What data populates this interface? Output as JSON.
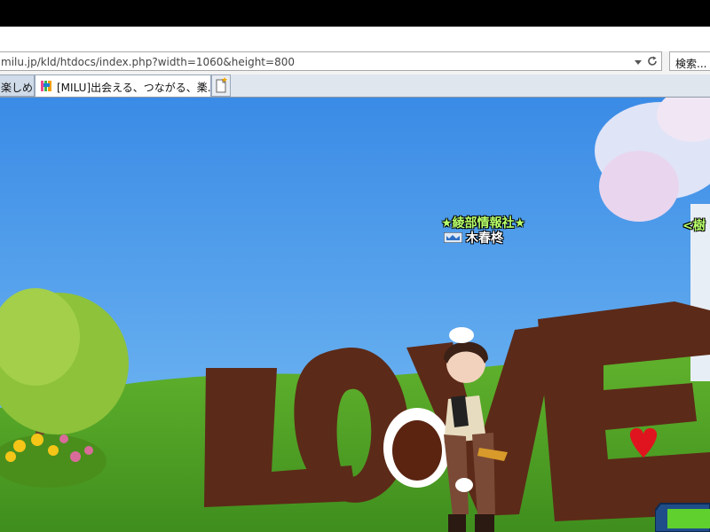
{
  "browser": {
    "address": {
      "url_dim": "milu.jp",
      "url_path": "/kld/htdocs/index.php?width=1060&height=800"
    },
    "search": {
      "label": "検索..."
    },
    "tabs": [
      {
        "label": "楽しめ..."
      },
      {
        "label": "[MILU]出会える、つながる、楽..."
      }
    ],
    "tab_close_glyph": "×"
  },
  "game": {
    "sign_text": "LOVE",
    "sign_color": "#5c2a18",
    "sky_color": "#4f9bea",
    "grass_color": "#5fae2c",
    "player": {
      "guild": "★綾部情報社★",
      "name": "木春柊"
    },
    "other_player": {
      "guild": "<樹"
    },
    "icons": [
      "crown-badge-icon",
      "heart-icon",
      "new-tab-icon",
      "refresh-icon",
      "dropdown-arrow-icon"
    ]
  }
}
